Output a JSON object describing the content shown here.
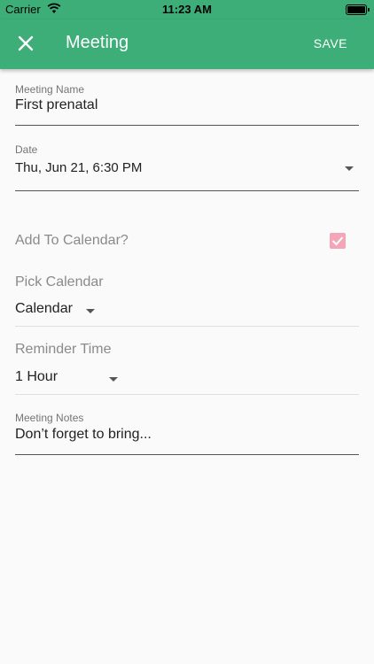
{
  "status_bar": {
    "carrier": "Carrier",
    "time": "11:23 AM"
  },
  "app_bar": {
    "title": "Meeting",
    "save_label": "SAVE",
    "background_color": "#3dae78"
  },
  "form": {
    "meeting_name": {
      "label": "Meeting Name",
      "value": "First prenatal"
    },
    "date": {
      "label": "Date",
      "value": "Thu, Jun 21, 6:30 PM"
    },
    "add_to_calendar": {
      "label": "Add To Calendar?",
      "checked": true,
      "checkbox_color": "#f3a6b7"
    },
    "pick_calendar": {
      "label": "Pick Calendar",
      "value": "Calendar"
    },
    "reminder_time": {
      "label": "Reminder Time",
      "value": "1 Hour"
    },
    "meeting_notes": {
      "label": "Meeting Notes",
      "value": "Don’t forget to bring..."
    }
  }
}
